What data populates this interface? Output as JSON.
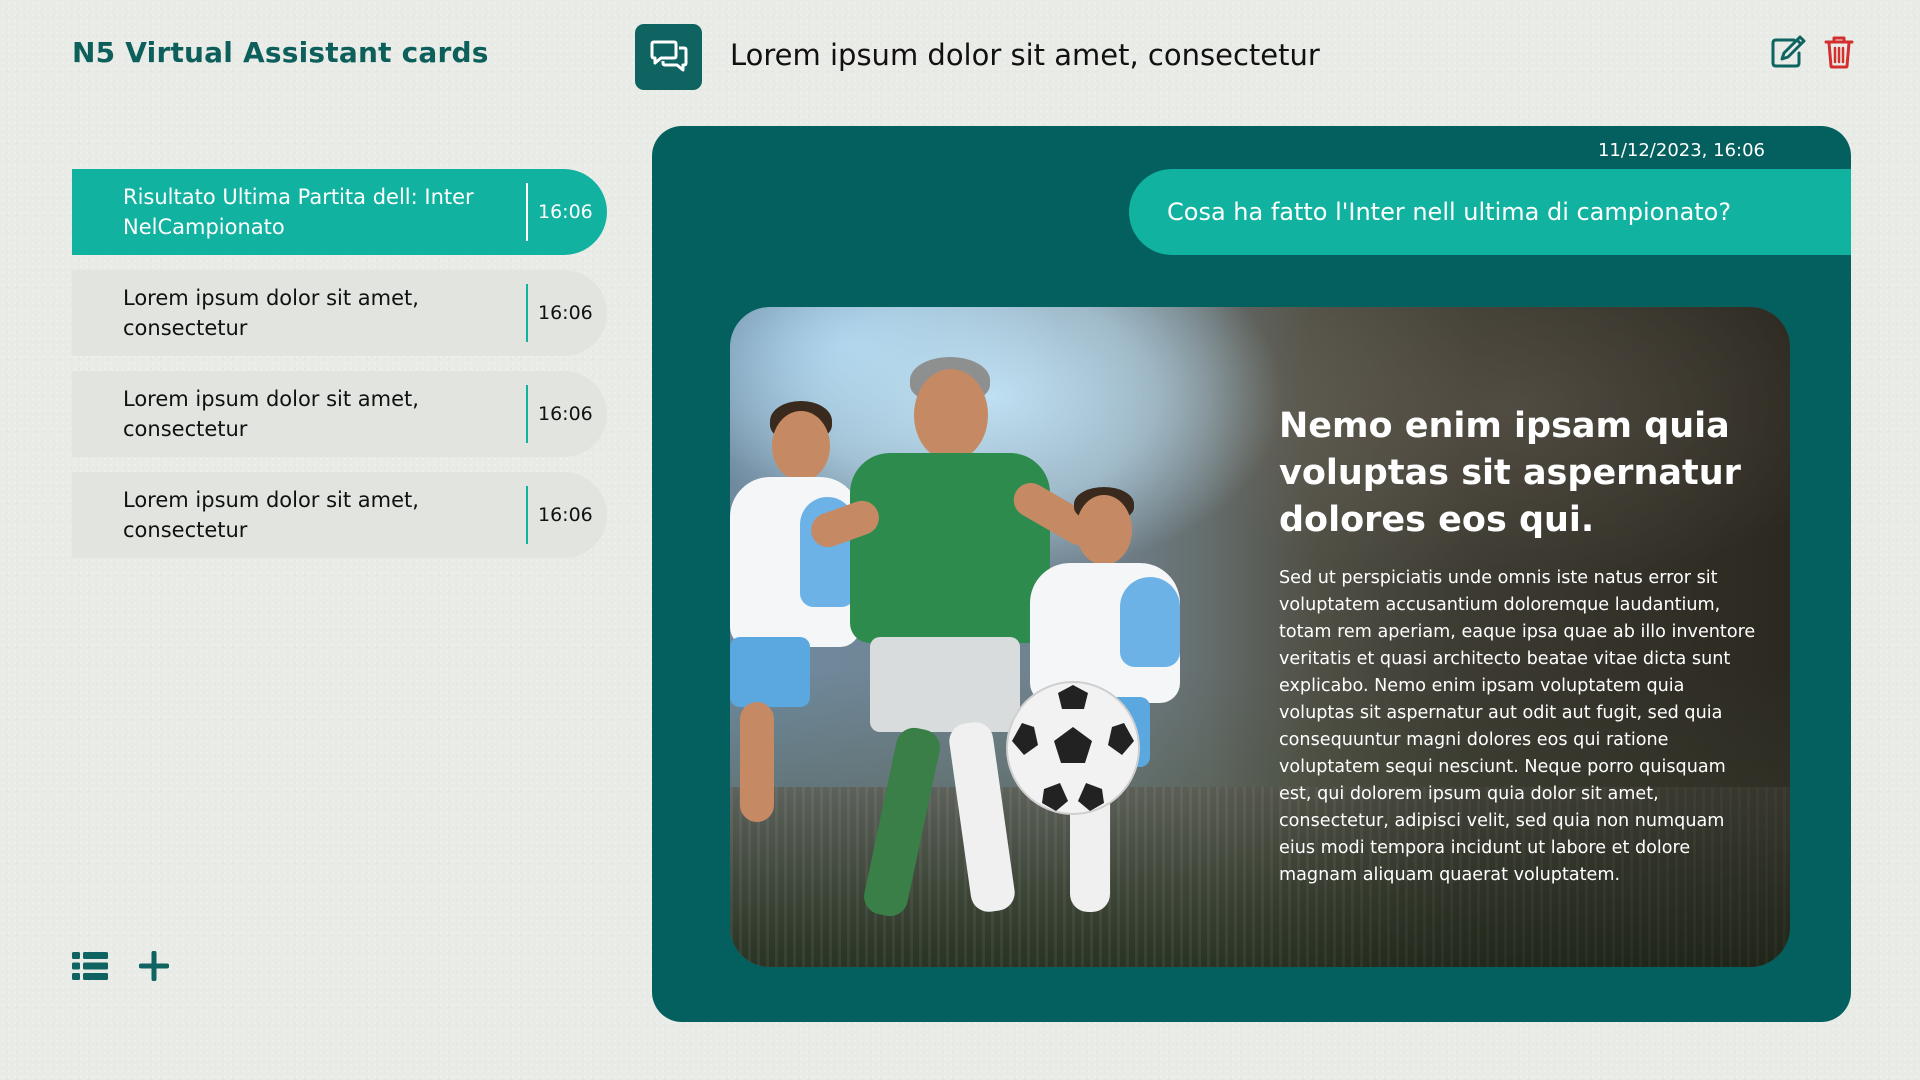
{
  "header": {
    "app_title": "N5 Virtual Assistant cards",
    "chat_title": "Lorem ipsum dolor sit amet, consectetur"
  },
  "icons": {
    "chat": "chat-bubbles-icon",
    "edit": "edit-icon",
    "delete": "trash-icon",
    "list": "list-icon",
    "add": "plus-icon"
  },
  "colors": {
    "brand_dark": "#0f6360",
    "accent": "#11b3a0",
    "panel": "#03605e",
    "delete": "#d32f2f"
  },
  "conversations": [
    {
      "title": "Risultato Ultima Partita dell: Inter NelCampionato",
      "time": "16:06",
      "active": true
    },
    {
      "title": "Lorem ipsum dolor sit amet, consectetur",
      "time": "16:06",
      "active": false
    },
    {
      "title": "Lorem ipsum dolor sit amet, consectetur",
      "time": "16:06",
      "active": false
    },
    {
      "title": "Lorem ipsum dolor sit amet, consectetur",
      "time": "16:06",
      "active": false
    }
  ],
  "chat": {
    "timestamp": "11/12/2023, 16:06",
    "user_message": "Cosa ha fatto l'Inter nell ultima di campionato?",
    "card": {
      "heading": "Nemo enim ipsam quia voluptas sit aspernatur dolores eos qui.",
      "body": "Sed ut perspiciatis unde omnis iste natus error sit voluptatem accusantium doloremque laudantium, totam rem aperiam, eaque ipsa quae ab illo inventore veritatis et quasi architecto beatae vitae dicta sunt explicabo. Nemo enim ipsam voluptatem quia voluptas sit aspernatur aut odit aut fugit, sed quia consequuntur magni dolores eos qui ratione voluptatem sequi nesciunt. Neque porro quisquam est, qui dolorem ipsum quia dolor sit amet, consectetur, adipisci velit, sed quia non numquam eius modi tempora incidunt ut labore et dolore magnam aliquam quaerat voluptatem."
    }
  }
}
